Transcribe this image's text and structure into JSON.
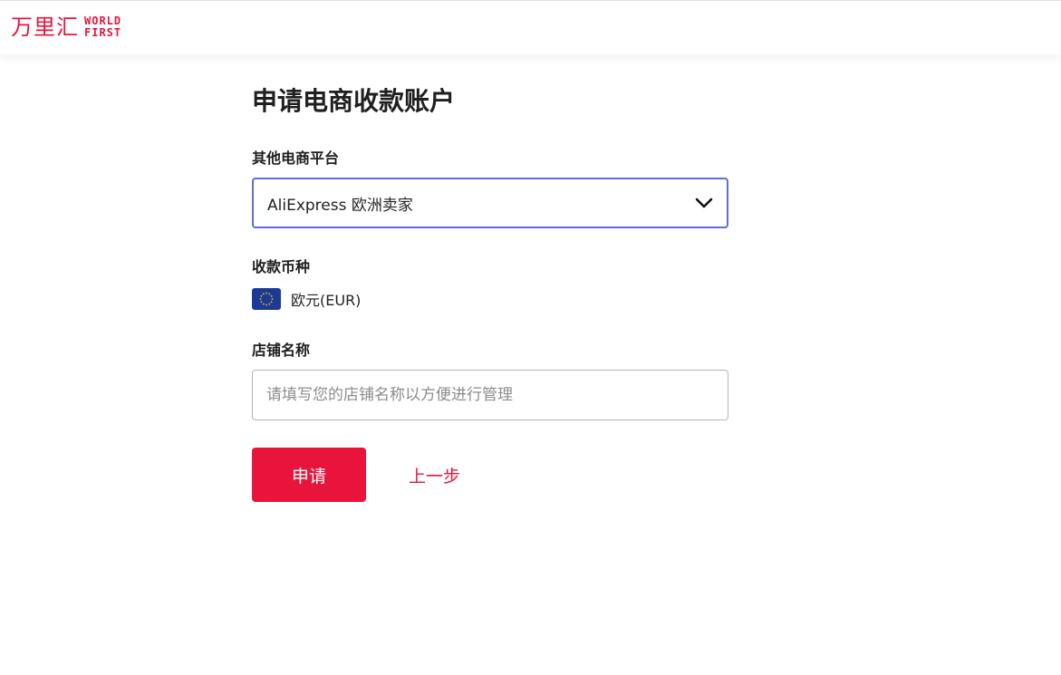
{
  "header": {
    "logo_cn": "万里汇",
    "logo_en_line1": "WORLD",
    "logo_en_line2": "FIRST"
  },
  "page": {
    "title": "申请电商收款账户"
  },
  "form": {
    "platform": {
      "label": "其他电商平台",
      "selected": "AliExpress 欧洲卖家",
      "icon": "chevron-down-icon"
    },
    "currency": {
      "label": "收款币种",
      "flag_icon": "eu-flag-icon",
      "value": "欧元(EUR)"
    },
    "store_name": {
      "label": "店铺名称",
      "value": "",
      "placeholder": "请填写您的店铺名称以方便进行管理"
    }
  },
  "actions": {
    "submit_label": "申请",
    "back_label": "上一步"
  },
  "colors": {
    "brand": "#e8143c",
    "focus_border": "#5b6ee1",
    "eu_blue": "#1c3a94",
    "eu_star": "#f5c518"
  }
}
